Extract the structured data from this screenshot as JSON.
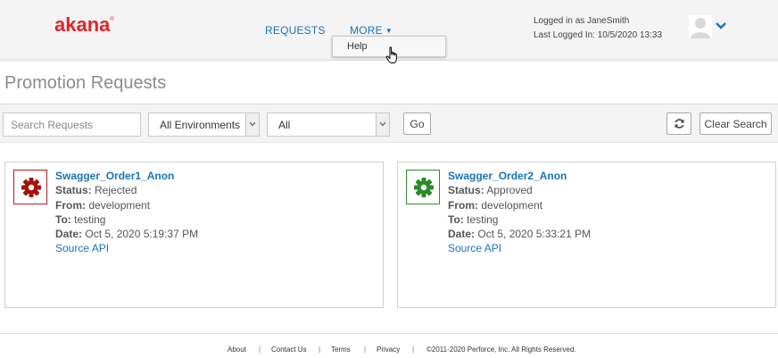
{
  "header": {
    "logo_text": "akana",
    "logo_mark": "®",
    "nav": {
      "requests_label": "REQUESTS",
      "more_label": "MORE",
      "more_caret": "▼"
    },
    "user": {
      "logged_in_as": "Logged in as JaneSmith",
      "last_logged_in": "Last Logged In: 10/5/2020 13:33"
    },
    "icons": {
      "avatar": "user-avatar-icon",
      "avatar_menu": "chevron-down-icon"
    }
  },
  "dropdown": {
    "items": [
      {
        "label": "Help"
      }
    ]
  },
  "page": {
    "title": "Promotion Requests"
  },
  "filters": {
    "search_placeholder": "Search Requests",
    "environment_selected": "All Environments",
    "status_selected": "All",
    "go_label": "Go",
    "refresh_icon": "refresh-icon",
    "clear_label": "Clear Search"
  },
  "requests": [
    {
      "name": "Swagger_Order1_Anon",
      "status_label": "Status:",
      "status": "Rejected",
      "from_label": "From:",
      "from": "development",
      "to_label": "To:",
      "to": "testing",
      "date_label": "Date:",
      "date": "Oct 5, 2020 5:19:37 PM",
      "link": "Source API",
      "icon": "gear-icon",
      "color": "#a4120c"
    },
    {
      "name": "Swagger_Order2_Anon",
      "status_label": "Status:",
      "status": "Approved",
      "from_label": "From:",
      "from": "development",
      "to_label": "To:",
      "to": "testing",
      "date_label": "Date:",
      "date": "Oct 5, 2020 5:33:21 PM",
      "link": "Source API",
      "icon": "gear-icon",
      "color": "#2a8a2a"
    }
  ],
  "footer": {
    "about": "About",
    "contact": "Contact Us",
    "terms": "Terms",
    "privacy": "Privacy",
    "separator": "|",
    "copyright": "©2011-2020 Perforce, Inc. All Rights Reserved."
  },
  "colors": {
    "brand": "#e0242c",
    "link": "#1a73b8",
    "rejected": "#a4120c",
    "approved": "#2a8a2a"
  }
}
